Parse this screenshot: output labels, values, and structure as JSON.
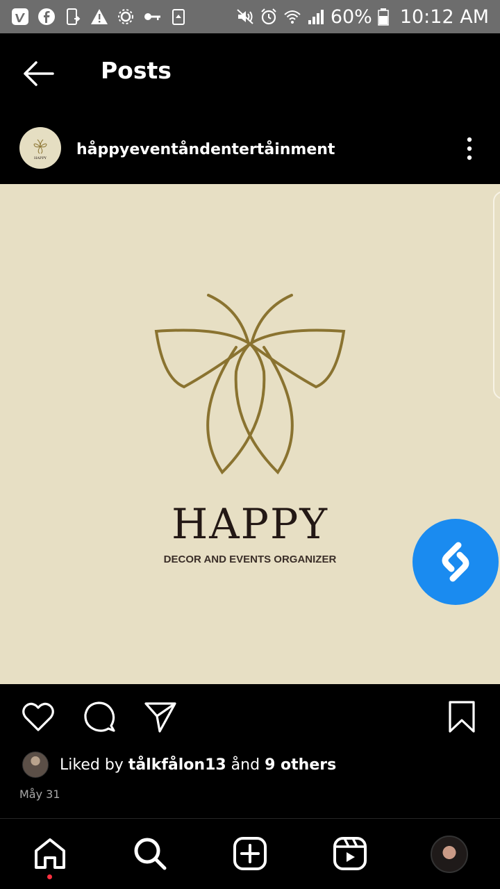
{
  "status_bar": {
    "left_icons": [
      "vimeo-icon",
      "facebook-icon",
      "phone-update-icon",
      "warning-icon",
      "settings-gear-icon",
      "key-icon",
      "recycle-icon"
    ],
    "right_icons": [
      "mute-icon",
      "alarm-icon",
      "wifi-icon",
      "signal-icon",
      "battery-icon"
    ],
    "battery": "60%",
    "time": "10:12 AM"
  },
  "header": {
    "back_icon": "back-arrow-icon",
    "title": "Posts"
  },
  "post": {
    "username": "håppyeventåndentertåinment",
    "avatar_text": "HAPPY",
    "more_icon": "more-vertical-icon",
    "image": {
      "brand_name": "HAPPY",
      "tagline": "DECOR AND EVENTS ORGANIZER",
      "background_color": "#e7dfc4",
      "logo_color": "#8a7330"
    },
    "actions": [
      "heart-icon",
      "comment-icon",
      "share-icon",
      "bookmark-icon"
    ],
    "likes": {
      "prefix": "Liked by ",
      "user": "tålkfålon13",
      "middle": " ånd ",
      "others": "9 others"
    },
    "date": "Måy 31"
  },
  "floating": {
    "icon": "shazam-icon",
    "color": "#1a8bf0"
  },
  "bottom_nav": {
    "items": [
      "home-icon",
      "search-icon",
      "create-icon",
      "reels-icon",
      "profile-avatar"
    ]
  }
}
